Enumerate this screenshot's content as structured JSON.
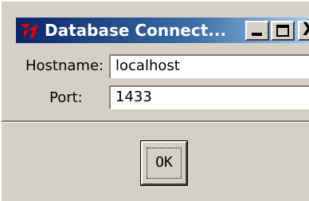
{
  "window": {
    "title": "Database Connect...",
    "app_icon": "tk-feather-icon",
    "controls": {
      "minimize_icon": "minimize-icon",
      "maximize_icon": "maximize-icon",
      "close_icon": "close-icon",
      "close_glyph": "X"
    }
  },
  "form": {
    "hostname_label": "Hostname:",
    "hostname_value": "localhost",
    "port_label": "Port:",
    "port_value": "1433"
  },
  "actions": {
    "ok_label": "OK"
  },
  "colors": {
    "titlebar_start": "#0a246a",
    "titlebar_end": "#a6caf0",
    "window_bg": "#d4d0c8"
  }
}
